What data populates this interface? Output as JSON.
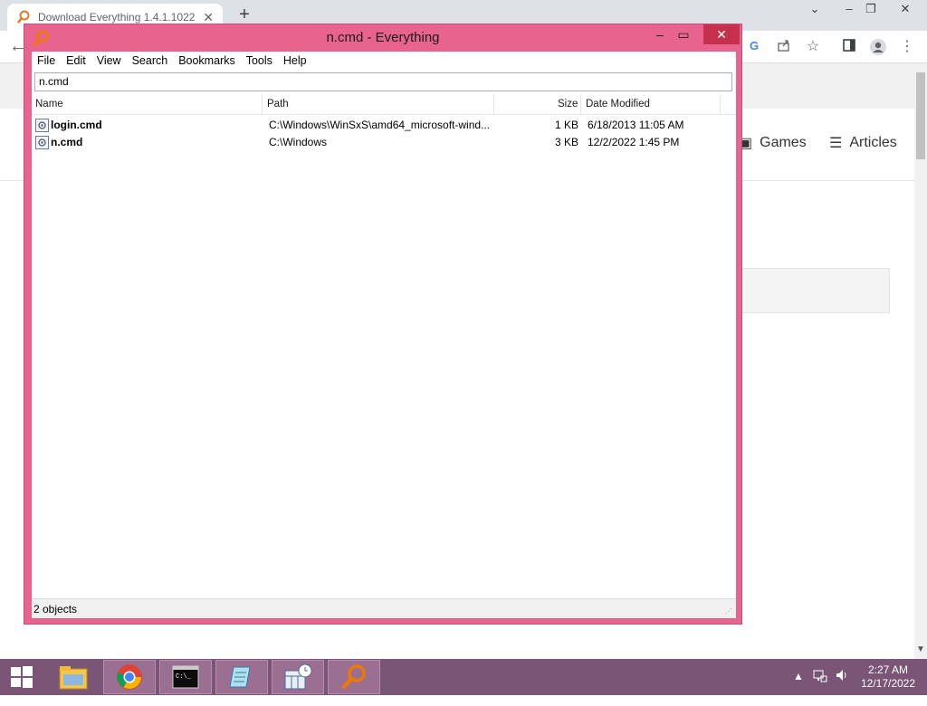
{
  "browser": {
    "tab_title": "Download Everything 1.4.1.1022",
    "tab_close": "✕",
    "new_tab": "+",
    "nav": [
      {
        "label": "Games",
        "icon": "gamepad-icon"
      },
      {
        "label": "Articles",
        "icon": "article-icon"
      }
    ],
    "toolbar_icons": [
      "google-lens-icon",
      "share-icon",
      "bookmark-star-icon",
      "sidebar-icon",
      "profile-icon",
      "menu-dots-icon"
    ]
  },
  "everything": {
    "title": "n.cmd - Everything",
    "close_glyph": "✕",
    "menu": [
      "File",
      "Edit",
      "View",
      "Search",
      "Bookmarks",
      "Tools",
      "Help"
    ],
    "search_value": "n.cmd",
    "columns": {
      "name": "Name",
      "path": "Path",
      "size": "Size",
      "date": "Date Modified"
    },
    "rows": [
      {
        "name": "login.cmd",
        "path": "C:\\Windows\\WinSxS\\amd64_microsoft-wind...",
        "size": "1 KB",
        "date": "6/18/2013 11:05 AM"
      },
      {
        "name": "n.cmd",
        "path": "C:\\Windows",
        "size": "3 KB",
        "date": "12/2/2022 1:45 PM"
      }
    ],
    "status": "2 objects"
  },
  "taskbar": {
    "apps": [
      "file-explorer-icon",
      "chrome-icon",
      "cmd-icon",
      "notepad-icon",
      "calendar-clock-icon",
      "everything-search-icon"
    ],
    "time": "2:27 AM",
    "date": "12/17/2022"
  },
  "colors": {
    "window_frame": "#e8648e",
    "taskbar": "#7b5575"
  }
}
